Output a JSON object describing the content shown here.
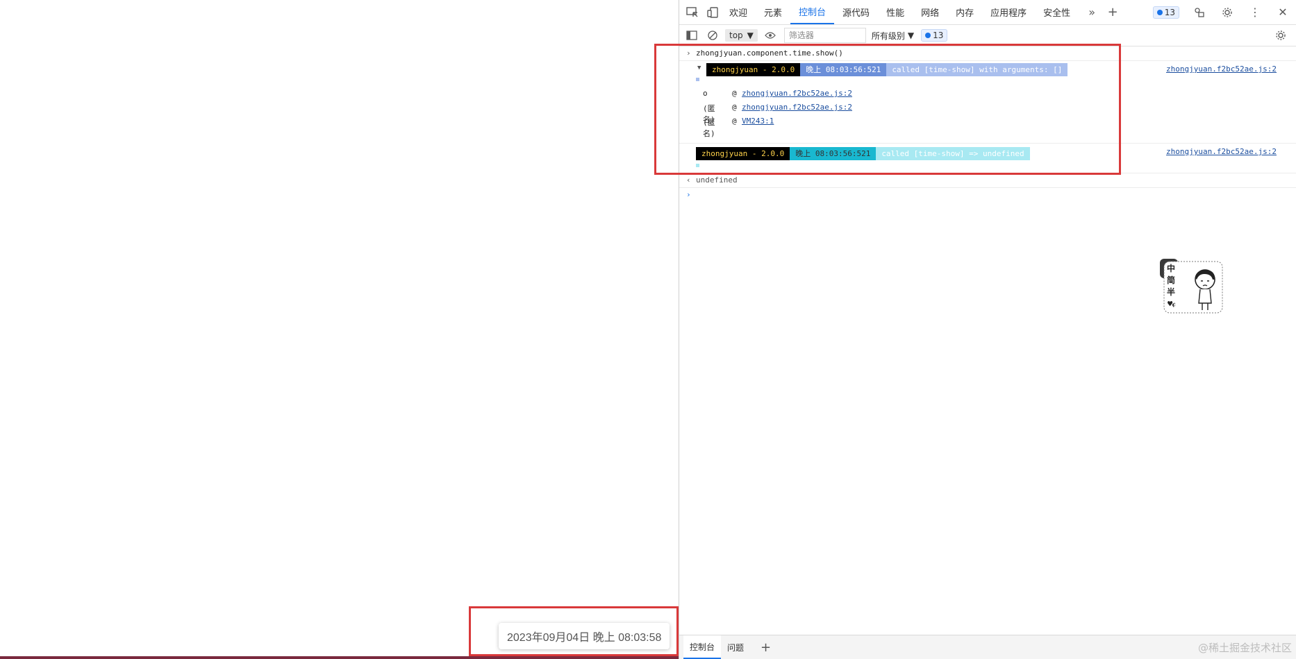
{
  "page": {
    "toast_text": "2023年09月04日 晚上 08:03:58"
  },
  "devtools": {
    "tabs": [
      "欢迎",
      "元素",
      "控制台",
      "源代码",
      "性能",
      "网络",
      "内存",
      "应用程序",
      "安全性"
    ],
    "active_tab": "控制台",
    "issue_count": "13",
    "toolbar": {
      "context": "top",
      "filter_placeholder": "筛选器",
      "levels_label": "所有级别",
      "message_count": "13"
    },
    "console": {
      "input_command": "zhongjyuan.component.time.show()",
      "log1": {
        "tag": "zhongjyuan - 2.0.0",
        "time": "晚上 08:03:56:521",
        "message": "called [time-show] with arguments: []",
        "source": "zhongjyuan.f2bc52ae.js:2",
        "stack": [
          {
            "fn": "o",
            "at": "@",
            "link": "zhongjyuan.f2bc52ae.js:2"
          },
          {
            "fn": "(匿名)",
            "at": "@",
            "link": "zhongjyuan.f2bc52ae.js:2"
          },
          {
            "fn": "(匿名)",
            "at": "@",
            "link": "VM243:1"
          }
        ]
      },
      "log2": {
        "tag": "zhongjyuan - 2.0.0",
        "time": "晚上 08:03:56:521",
        "message": "called [time-show] => undefined",
        "source": "zhongjyuan.f2bc52ae.js:2"
      },
      "return_value": "undefined"
    },
    "drawer_tabs": [
      "控制台",
      "问题"
    ],
    "mascot_text": [
      "中",
      "简",
      "半"
    ]
  },
  "watermark": "@稀土掘金技术社区",
  "colors": {
    "highlight_box": "#d9393a",
    "tag_bg": "#000000",
    "tag_fg": "#ffd24a",
    "time1_bg": "#6b8fd9",
    "msg1_bg": "#a9bfee",
    "time2_bg": "#19b8d0",
    "msg2_bg": "#a8e9f2",
    "link": "#1a4d9e",
    "accent": "#1a73e8"
  }
}
